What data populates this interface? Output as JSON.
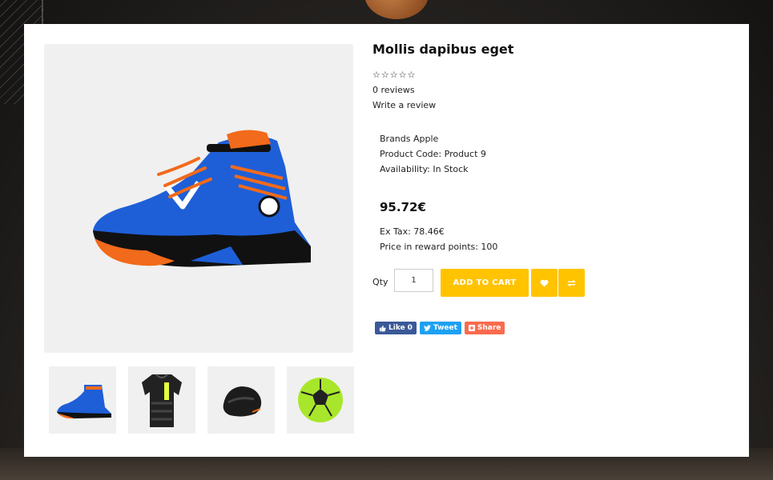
{
  "product": {
    "title": "Mollis dapibus eget",
    "rating_stars": "☆☆☆☆☆",
    "reviews": "0 reviews",
    "write_review": "Write a review",
    "brands": "Brands Apple",
    "product_code": "Product Code: Product 9",
    "availability": "Availability: In Stock",
    "price": "95.72€",
    "ex_tax": "Ex Tax: 78.46€",
    "reward_points": "Price in reward points: 100"
  },
  "purchase": {
    "qty_label": "Qty",
    "qty_value": "1",
    "add_to_cart": "ADD TO CART"
  },
  "social": {
    "like": "Like",
    "like_count": "0",
    "tweet": "Tweet",
    "share": "Share"
  },
  "images": {
    "main": "basketball-shoe",
    "thumbnails": [
      "basketball-shoe",
      "black-sports-jersey",
      "black-shoe-angled",
      "green-soccer-ball"
    ]
  },
  "colors": {
    "accent": "#ffc300",
    "facebook": "#3b5998",
    "twitter": "#1da1f2",
    "share": "#fa6b4e"
  }
}
